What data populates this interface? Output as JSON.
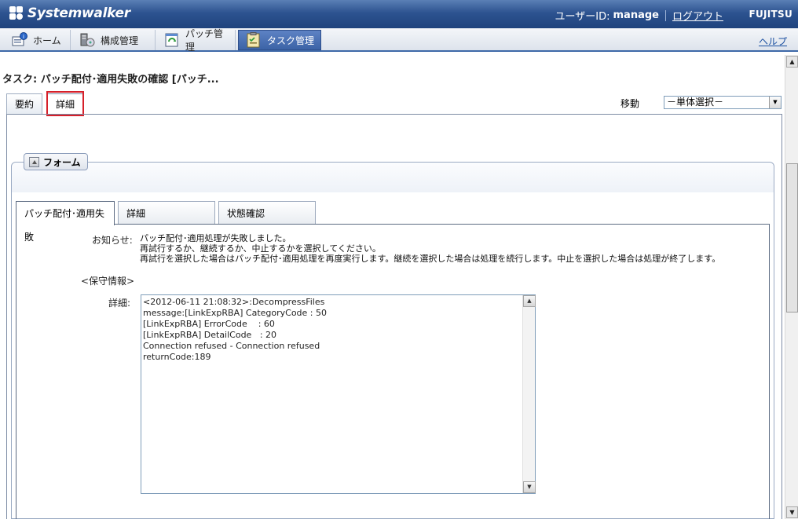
{
  "header": {
    "logo_text": "Systemwalker",
    "user_label": "ユーザーID:",
    "user_id": "manage",
    "logout": "ログアウト",
    "brand": "FUJITSU"
  },
  "nav": {
    "tabs": [
      {
        "label": "ホーム",
        "icon": "home-icon"
      },
      {
        "label": "構成管理",
        "icon": "configuration-icon"
      },
      {
        "label": "パッチ管理",
        "icon": "patch-icon"
      },
      {
        "label": "タスク管理",
        "icon": "task-icon",
        "active": true
      }
    ],
    "help": "ヘルプ"
  },
  "page": {
    "title": "タスク: パッチ配付･適用失敗の確認 [パッチ...",
    "tabs": [
      "要約",
      "詳細"
    ],
    "active_tab": "詳細",
    "move_label": "移動",
    "move_select": "－単体選択－"
  },
  "form": {
    "legend": "フォーム",
    "tabs": [
      "パッチ配付･適用失敗",
      "詳細",
      "状態確認"
    ],
    "notice_label": "お知らせ:",
    "notice_lines": [
      "パッチ配付･適用処理が失敗しました。",
      "再試行するか、継続するか、中止するかを選択してください。",
      "再試行を選択した場合はパッチ配付･適用処理を再度実行します。継続を選択した場合は処理を続行します。中止を選択した場合は処理が終了します。"
    ],
    "maintenance_label": "<保守情報>",
    "detail_label": "詳細:",
    "detail_lines": [
      "<2012-06-11 21:08:32>:DecompressFiles",
      "message:[LinkExpRBA] CategoryCode : 50",
      "[LinkExpRBA] ErrorCode    : 60",
      "[LinkExpRBA] DetailCode   : 20",
      "Connection refused - Connection refused",
      "returnCode:189"
    ]
  },
  "colors": {
    "header": "#2d5390",
    "nav_active": "#3c63a6",
    "focus_outline": "#d6202a"
  }
}
